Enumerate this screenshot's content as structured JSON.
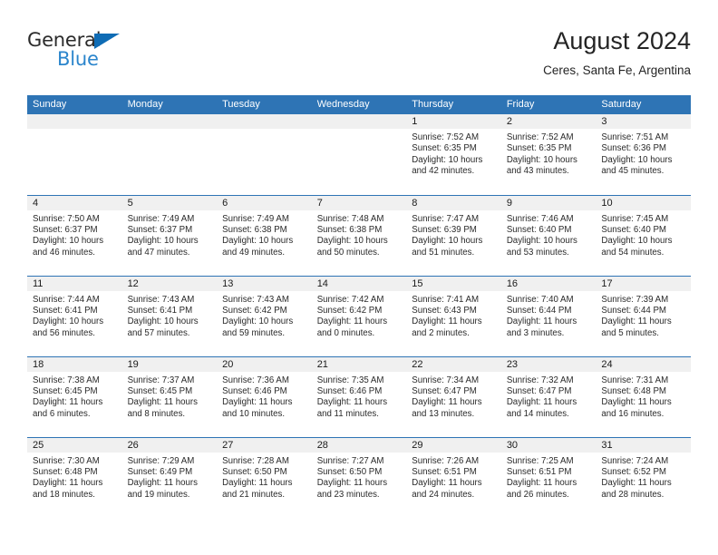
{
  "brand": {
    "name_part1": "General",
    "name_part2": "Blue",
    "accent_color": "#2b85cc",
    "triangle_color": "#0f6cb5",
    "logo_icon": "triangle-flag-icon"
  },
  "header": {
    "title": "August 2024",
    "subtitle": "Ceres, Santa Fe, Argentina"
  },
  "theme": {
    "header_bg": "#2e74b5",
    "header_text": "#ffffff",
    "daynum_band_bg": "#f0f0f0",
    "row_divider": "#2e74b5"
  },
  "weekdays": [
    "Sunday",
    "Monday",
    "Tuesday",
    "Wednesday",
    "Thursday",
    "Friday",
    "Saturday"
  ],
  "weeks": [
    [
      {
        "day": "",
        "sunrise": "",
        "sunset": "",
        "daylight": "",
        "empty": true
      },
      {
        "day": "",
        "sunrise": "",
        "sunset": "",
        "daylight": "",
        "empty": true
      },
      {
        "day": "",
        "sunrise": "",
        "sunset": "",
        "daylight": "",
        "empty": true
      },
      {
        "day": "",
        "sunrise": "",
        "sunset": "",
        "daylight": "",
        "empty": true
      },
      {
        "day": "1",
        "sunrise": "Sunrise: 7:52 AM",
        "sunset": "Sunset: 6:35 PM",
        "daylight": "Daylight: 10 hours and 42 minutes.",
        "empty": false
      },
      {
        "day": "2",
        "sunrise": "Sunrise: 7:52 AM",
        "sunset": "Sunset: 6:35 PM",
        "daylight": "Daylight: 10 hours and 43 minutes.",
        "empty": false
      },
      {
        "day": "3",
        "sunrise": "Sunrise: 7:51 AM",
        "sunset": "Sunset: 6:36 PM",
        "daylight": "Daylight: 10 hours and 45 minutes.",
        "empty": false
      }
    ],
    [
      {
        "day": "4",
        "sunrise": "Sunrise: 7:50 AM",
        "sunset": "Sunset: 6:37 PM",
        "daylight": "Daylight: 10 hours and 46 minutes.",
        "empty": false
      },
      {
        "day": "5",
        "sunrise": "Sunrise: 7:49 AM",
        "sunset": "Sunset: 6:37 PM",
        "daylight": "Daylight: 10 hours and 47 minutes.",
        "empty": false
      },
      {
        "day": "6",
        "sunrise": "Sunrise: 7:49 AM",
        "sunset": "Sunset: 6:38 PM",
        "daylight": "Daylight: 10 hours and 49 minutes.",
        "empty": false
      },
      {
        "day": "7",
        "sunrise": "Sunrise: 7:48 AM",
        "sunset": "Sunset: 6:38 PM",
        "daylight": "Daylight: 10 hours and 50 minutes.",
        "empty": false
      },
      {
        "day": "8",
        "sunrise": "Sunrise: 7:47 AM",
        "sunset": "Sunset: 6:39 PM",
        "daylight": "Daylight: 10 hours and 51 minutes.",
        "empty": false
      },
      {
        "day": "9",
        "sunrise": "Sunrise: 7:46 AM",
        "sunset": "Sunset: 6:40 PM",
        "daylight": "Daylight: 10 hours and 53 minutes.",
        "empty": false
      },
      {
        "day": "10",
        "sunrise": "Sunrise: 7:45 AM",
        "sunset": "Sunset: 6:40 PM",
        "daylight": "Daylight: 10 hours and 54 minutes.",
        "empty": false
      }
    ],
    [
      {
        "day": "11",
        "sunrise": "Sunrise: 7:44 AM",
        "sunset": "Sunset: 6:41 PM",
        "daylight": "Daylight: 10 hours and 56 minutes.",
        "empty": false
      },
      {
        "day": "12",
        "sunrise": "Sunrise: 7:43 AM",
        "sunset": "Sunset: 6:41 PM",
        "daylight": "Daylight: 10 hours and 57 minutes.",
        "empty": false
      },
      {
        "day": "13",
        "sunrise": "Sunrise: 7:43 AM",
        "sunset": "Sunset: 6:42 PM",
        "daylight": "Daylight: 10 hours and 59 minutes.",
        "empty": false
      },
      {
        "day": "14",
        "sunrise": "Sunrise: 7:42 AM",
        "sunset": "Sunset: 6:42 PM",
        "daylight": "Daylight: 11 hours and 0 minutes.",
        "empty": false
      },
      {
        "day": "15",
        "sunrise": "Sunrise: 7:41 AM",
        "sunset": "Sunset: 6:43 PM",
        "daylight": "Daylight: 11 hours and 2 minutes.",
        "empty": false
      },
      {
        "day": "16",
        "sunrise": "Sunrise: 7:40 AM",
        "sunset": "Sunset: 6:44 PM",
        "daylight": "Daylight: 11 hours and 3 minutes.",
        "empty": false
      },
      {
        "day": "17",
        "sunrise": "Sunrise: 7:39 AM",
        "sunset": "Sunset: 6:44 PM",
        "daylight": "Daylight: 11 hours and 5 minutes.",
        "empty": false
      }
    ],
    [
      {
        "day": "18",
        "sunrise": "Sunrise: 7:38 AM",
        "sunset": "Sunset: 6:45 PM",
        "daylight": "Daylight: 11 hours and 6 minutes.",
        "empty": false
      },
      {
        "day": "19",
        "sunrise": "Sunrise: 7:37 AM",
        "sunset": "Sunset: 6:45 PM",
        "daylight": "Daylight: 11 hours and 8 minutes.",
        "empty": false
      },
      {
        "day": "20",
        "sunrise": "Sunrise: 7:36 AM",
        "sunset": "Sunset: 6:46 PM",
        "daylight": "Daylight: 11 hours and 10 minutes.",
        "empty": false
      },
      {
        "day": "21",
        "sunrise": "Sunrise: 7:35 AM",
        "sunset": "Sunset: 6:46 PM",
        "daylight": "Daylight: 11 hours and 11 minutes.",
        "empty": false
      },
      {
        "day": "22",
        "sunrise": "Sunrise: 7:34 AM",
        "sunset": "Sunset: 6:47 PM",
        "daylight": "Daylight: 11 hours and 13 minutes.",
        "empty": false
      },
      {
        "day": "23",
        "sunrise": "Sunrise: 7:32 AM",
        "sunset": "Sunset: 6:47 PM",
        "daylight": "Daylight: 11 hours and 14 minutes.",
        "empty": false
      },
      {
        "day": "24",
        "sunrise": "Sunrise: 7:31 AM",
        "sunset": "Sunset: 6:48 PM",
        "daylight": "Daylight: 11 hours and 16 minutes.",
        "empty": false
      }
    ],
    [
      {
        "day": "25",
        "sunrise": "Sunrise: 7:30 AM",
        "sunset": "Sunset: 6:48 PM",
        "daylight": "Daylight: 11 hours and 18 minutes.",
        "empty": false
      },
      {
        "day": "26",
        "sunrise": "Sunrise: 7:29 AM",
        "sunset": "Sunset: 6:49 PM",
        "daylight": "Daylight: 11 hours and 19 minutes.",
        "empty": false
      },
      {
        "day": "27",
        "sunrise": "Sunrise: 7:28 AM",
        "sunset": "Sunset: 6:50 PM",
        "daylight": "Daylight: 11 hours and 21 minutes.",
        "empty": false
      },
      {
        "day": "28",
        "sunrise": "Sunrise: 7:27 AM",
        "sunset": "Sunset: 6:50 PM",
        "daylight": "Daylight: 11 hours and 23 minutes.",
        "empty": false
      },
      {
        "day": "29",
        "sunrise": "Sunrise: 7:26 AM",
        "sunset": "Sunset: 6:51 PM",
        "daylight": "Daylight: 11 hours and 24 minutes.",
        "empty": false
      },
      {
        "day": "30",
        "sunrise": "Sunrise: 7:25 AM",
        "sunset": "Sunset: 6:51 PM",
        "daylight": "Daylight: 11 hours and 26 minutes.",
        "empty": false
      },
      {
        "day": "31",
        "sunrise": "Sunrise: 7:24 AM",
        "sunset": "Sunset: 6:52 PM",
        "daylight": "Daylight: 11 hours and 28 minutes.",
        "empty": false
      }
    ]
  ]
}
